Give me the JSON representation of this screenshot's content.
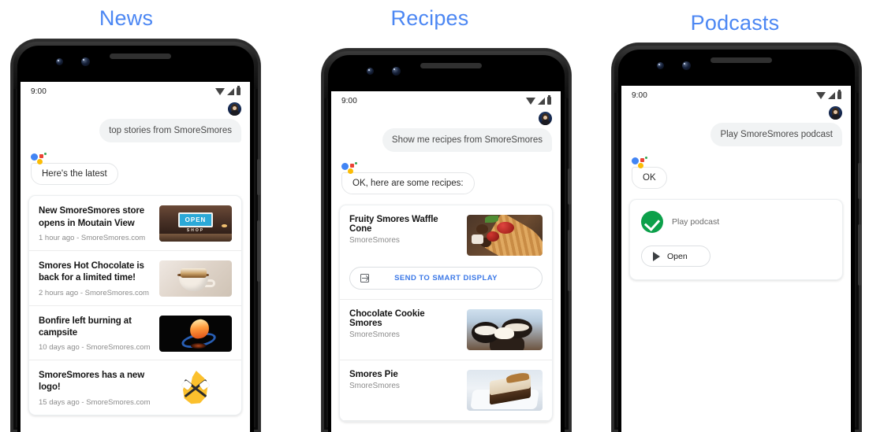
{
  "theme": {
    "title_color": "#4C87F3",
    "link_color": "#3B78E7",
    "success_green": "#0CA04A"
  },
  "columns": [
    {
      "title": "News"
    },
    {
      "title": "Recipes"
    },
    {
      "title": "Podcasts"
    }
  ],
  "phones": {
    "news": {
      "status": {
        "clock": "9:00"
      },
      "user_message": "top stories from SmoreSmores",
      "assistant_message": "Here's the latest",
      "items": [
        {
          "title": "New SmoreSmores store opens in Moutain View",
          "meta": "1 hour ago - SmoreSmores.com",
          "thumb": "open-shop-sign-photo"
        },
        {
          "title": "Smores Hot Chocolate is back for a limited time!",
          "meta": "2 hours ago - SmoreSmores.com",
          "thumb": "hot-chocolate-photo"
        },
        {
          "title": "Bonfire left burning at campsite",
          "meta": "10 days ago - SmoreSmores.com",
          "thumb": "bonfire-photo"
        },
        {
          "title": "SmoreSmores has a new logo!",
          "meta": "15 days ago - SmoreSmores.com",
          "thumb": "smoresmores-flame-logo"
        }
      ]
    },
    "recipes": {
      "status": {
        "clock": "9:00"
      },
      "user_message": "Show me recipes from SmoreSmores",
      "assistant_message": "OK, here are some recipes:",
      "send_button_label": "SEND TO SMART DISPLAY",
      "items": [
        {
          "title": "Fruity Smores Waffle Cone",
          "source": "SmoreSmores",
          "thumb": "waffle-cone-photo"
        },
        {
          "title": "Chocolate Cookie Smores",
          "source": "SmoreSmores",
          "thumb": "chocolate-cookie-photo"
        },
        {
          "title": "Smores Pie",
          "source": "SmoreSmores",
          "thumb": "smores-pie-photo"
        }
      ]
    },
    "podcasts": {
      "status": {
        "clock": "9:00"
      },
      "user_message": "Play SmoreSmores podcast",
      "assistant_message": "OK",
      "result_label": "Play podcast",
      "open_button_label": "Open"
    }
  }
}
